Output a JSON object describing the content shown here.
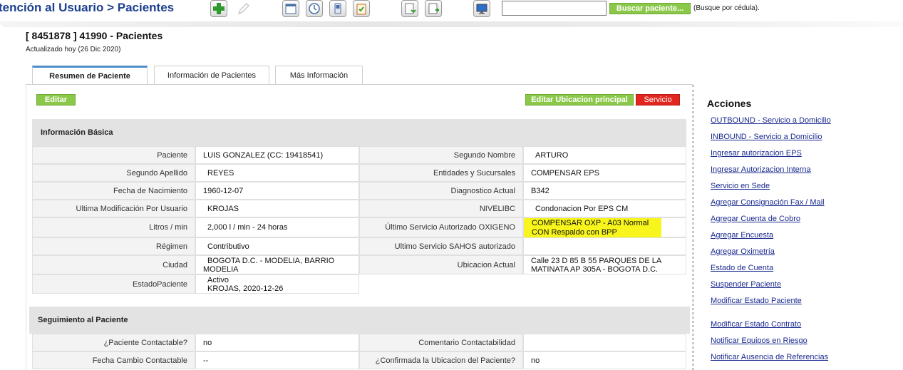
{
  "header": {
    "title": "tención al Usuario > Pacientes",
    "search_placeholder": "",
    "search_button": "Buscar paciente...",
    "search_hint": "(Busque por cédula)."
  },
  "toolbar_icons": [
    "add-icon",
    "edit-icon",
    "calendar-icon",
    "clock-icon",
    "phone-icon",
    "clipboard-icon",
    "document-download-icon",
    "document-add-icon",
    "monitor-icon"
  ],
  "patient": {
    "title": "[ 8451878 ] 41990 - Pacientes",
    "updated": "Actualizado hoy (26 Dic 2020)"
  },
  "tabs": [
    {
      "label": "Resumen de Paciente",
      "active": true
    },
    {
      "label": "Información de Pacientes",
      "active": false
    },
    {
      "label": "Más Información",
      "active": false
    }
  ],
  "buttons": {
    "edit": "Editar",
    "edit_location": "Editar Ubicacion principal",
    "service": "Servicio"
  },
  "basic_info": {
    "title": "Información Básica",
    "left": [
      {
        "label": "Paciente",
        "value": "LUIS GONZALEZ (CC: 19418541)"
      },
      {
        "label": "Segundo Apellido",
        "value": "REYES"
      },
      {
        "label": "Fecha de Nacimiento",
        "value": "1960-12-07"
      },
      {
        "label": "Ultima Modificación Por Usuario",
        "value": "KROJAS"
      },
      {
        "label": "Litros / min",
        "value": "2,000 l / min - 24 horas"
      },
      {
        "label": "Régimen",
        "value": "Contributivo"
      },
      {
        "label": "Ciudad",
        "value": "BOGOTA D.C. - MODELIA, BARRIO MODELIA"
      },
      {
        "label": "EstadoPaciente",
        "value": "Activo",
        "value2": "KROJAS, 2020-12-26"
      }
    ],
    "right": [
      {
        "label": "Segundo Nombre",
        "value": "ARTURO"
      },
      {
        "label": "Entidades y Sucursales",
        "value": "COMPENSAR EPS"
      },
      {
        "label": "Diagnostico Actual",
        "value": "B342"
      },
      {
        "label": "NIVELIBC",
        "value": "Condonacion Por EPS CM"
      },
      {
        "label": "Último Servicio Autorizado OXIGENO",
        "value": "COMPENSAR OXP - A03 Normal CON Respaldo con BPP",
        "highlight": true
      },
      {
        "label": "Ultimo Servicio SAHOS autorizado",
        "value": ""
      },
      {
        "label": "Ubicacion Actual",
        "value": "Calle 23 D 85 B 55 PARQUES DE LA MATINATA AP 305A - BOGOTA D.C."
      }
    ]
  },
  "followup": {
    "title": "Seguimiento al Paciente",
    "left": [
      {
        "label": "¿Paciente Contactable?",
        "value": "no"
      },
      {
        "label": "Fecha Cambio Contactable",
        "value": "--"
      }
    ],
    "right": [
      {
        "label": "Comentario Contactabilidad",
        "value": ""
      },
      {
        "label": "¿Confirmada la Ubicacion del Paciente?",
        "value": "no"
      }
    ]
  },
  "actions": {
    "title": "Acciones",
    "links": [
      "OUTBOUND - Servicio a Domicilio",
      "INBOUND - Servicio a Domicilio",
      "Ingresar autorizacion EPS",
      "Ingresar Autorizacion Interna",
      "Servicio en Sede",
      "Agregar Consignación Fax / Mail",
      "Agregar Cuenta de Cobro",
      "Agregar Encuesta",
      "Agregar Oximetría",
      "Estado de Cuenta",
      "Suspender Paciente",
      "Modificar Estado Paciente",
      "Modificar Estado Contrato",
      "Notificar Equipos en Riesgo",
      "Notificar Ausencia de Referencias"
    ]
  }
}
